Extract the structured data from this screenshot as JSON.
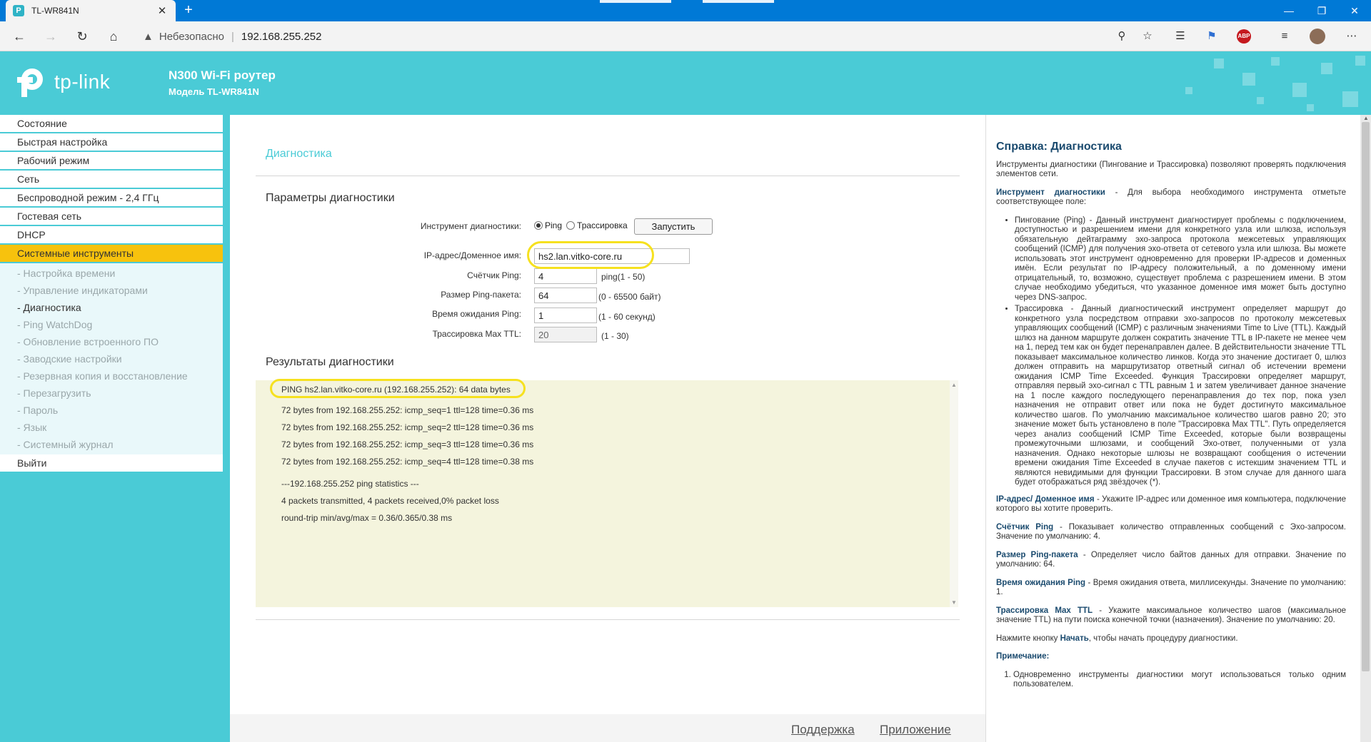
{
  "browser": {
    "tab_title": "TL-WR841N",
    "tab_favicon_letter": "P",
    "url_security_label": "Небезопасно",
    "url": "192.168.255.252"
  },
  "router": {
    "logo_text": "tp-link",
    "product_name": "N300 Wi-Fi роутер",
    "model": "Модель TL-WR841N"
  },
  "menu": {
    "items_top": [
      "Состояние",
      "Быстрая настройка",
      "Рабочий режим",
      "Сеть",
      "Беспроводной режим - 2,4 ГГц",
      "Гостевая сеть",
      "DHCP"
    ],
    "active_item": "Системные инструменты",
    "sub_items": [
      "- Настройка времени",
      "- Управление индикаторами",
      "- Диагностика",
      "- Ping WatchDog",
      "- Обновление встроенного ПО",
      "- Заводские настройки",
      "- Резервная копия и восстановление",
      "- Перезагрузить",
      "- Пароль",
      "- Язык",
      "- Системный журнал"
    ],
    "current_sub_index": 2,
    "logout": "Выйти"
  },
  "main": {
    "title": "Диагностика",
    "params_title": "Параметры диагностики",
    "tool_label": "Инструмент диагностики:",
    "tool_ping": "Ping",
    "tool_trace": "Трассировка",
    "tool_selected": "Ping",
    "run_button": "Запустить",
    "ip_label": "IP-адрес/Доменное имя:",
    "ip_value": "hs2.lan.vitko-core.ru",
    "count_label": "Счётчик Ping:",
    "count_value": "4",
    "count_hint": "ping(1 - 50)",
    "size_label": "Размер Ping-пакета:",
    "size_value": "64",
    "size_hint": "(0 - 65500 байт)",
    "timeout_label": "Время ожидания Ping:",
    "timeout_value": "1",
    "timeout_hint": "(1 - 60 секунд)",
    "ttl_label": "Трассировка Max TTL:",
    "ttl_value": "20",
    "ttl_hint": "(1 - 30)",
    "results_title": "Результаты диагностики",
    "results_lines": [
      "PING hs2.lan.vitko-core.ru (192.168.255.252): 64 data bytes",
      "72 bytes from 192.168.255.252: icmp_seq=1 ttl=128 time=0.36 ms",
      "72 bytes from 192.168.255.252: icmp_seq=2 ttl=128 time=0.36 ms",
      "72 bytes from 192.168.255.252: icmp_seq=3 ttl=128 time=0.36 ms",
      "72 bytes from 192.168.255.252: icmp_seq=4 ttl=128 time=0.38 ms",
      "---192.168.255.252 ping statistics ---",
      "4 packets transmitted, 4 packets received,0% packet loss",
      "round-trip min/avg/max = 0.36/0.365/0.38 ms"
    ],
    "footer_support": "Поддержка",
    "footer_app": "Приложение"
  },
  "help": {
    "title": "Справка: Диагностика",
    "intro": "Инструменты диагностики (Пингование и Трассировка) позволяют проверять подключения элементов сети.",
    "tool_key": "Инструмент диагностики",
    "tool_text": " - Для выбора необходимого инструмента отметьте соответствующее поле:",
    "ping_item": "Пингование (Ping) - Данный инструмент диагностирует проблемы с подключением, доступностью и разрешением имени для конкретного узла или шлюза, используя обязательную дейтаграмму эхо-запроса протокола межсетевых управляющих сообщений (ICMP) для получения эхо-ответа от сетевого узла или шлюза. Вы можете использовать этот инструмент одновременно для проверки IP-адресов и доменных имён. Если результат по IP-адресу положительный, а по доменному имени отрицательный, то, возможно, существует проблема с разрешением имени. В этом случае необходимо убедиться, что указанное доменное имя может быть доступно через DNS-запрос.",
    "trace_item": "Трассировка - Данный диагностический инструмент определяет маршрут до конкретного узла посредством отправки эхо-запросов по протоколу межсетевых управляющих сообщений (ICMP) с различным значениями Time to Live (TTL). Каждый шлюз на данном маршруте должен сократить значение TTL в IP-пакете не менее чем на 1, перед тем как он будет перенаправлен далее. В действительности значение TTL показывает максимальное количество линков. Когда это значение достигает 0, шлюз должен отправить на маршрутизатор ответный сигнал об истечении времени ожидания ICMP Time Exceeded. Функция Трассировки определяет маршрут, отправляя первый эхо-сигнал с TTL равным 1 и затем увеличивает данное значение на 1 после каждого последующего перенаправления до тех пор, пока узел назначения не отправит ответ или пока не будет достигнуто максимальное количество шагов. По умолчанию максимальное количество шагов равно 20; это значение может быть установлено в поле \"Трассировка Max TTL\". Путь определяется через анализ сообщений ICMP Time Exceeded, которые были возвращены промежуточными шлюзами, и сообщений Эхо-ответ, полученными от узла назначения. Однако некоторые шлюзы не возвращают сообщения о истечении времени ожидания Time Exceeded в случае пакетов с истекшим значением TTL и являются невидимыми для функции Трассировки. В этом случае для данного шага будет отображаться ряд звёздочек (*).",
    "ip_key": "IP-адрес/ Доменное имя",
    "ip_text": " - Укажите IP-адрес или доменное имя компьютера, подключение которого вы хотите проверить.",
    "count_key": "Счётчик Ping",
    "count_text": " - Показывает количество отправленных сообщений с Эхо-запросом. Значение по умолчанию: 4.",
    "size_key": "Размер Ping-пакета",
    "size_text": " - Определяет число байтов данных для отправки. Значение по умолчанию: 64.",
    "timeout_key": "Время ожидания Ping",
    "timeout_text": " - Время ожидания ответа, миллисекунды. Значение по умолчанию: 1.",
    "ttl_key": "Трассировка Max TTL",
    "ttl_text": " - Укажите максимальное количество шагов (максимальное значение TTL) на пути поиска конечной точки (назначения). Значение по умолчанию: 20.",
    "start_pre": "Нажмите кнопку ",
    "start_key": "Начать",
    "start_post": ", чтобы начать процедуру диагностики.",
    "note_title": "Примечание:",
    "note_1": "Одновременно инструменты диагностики могут использоваться только одним пользователем."
  }
}
